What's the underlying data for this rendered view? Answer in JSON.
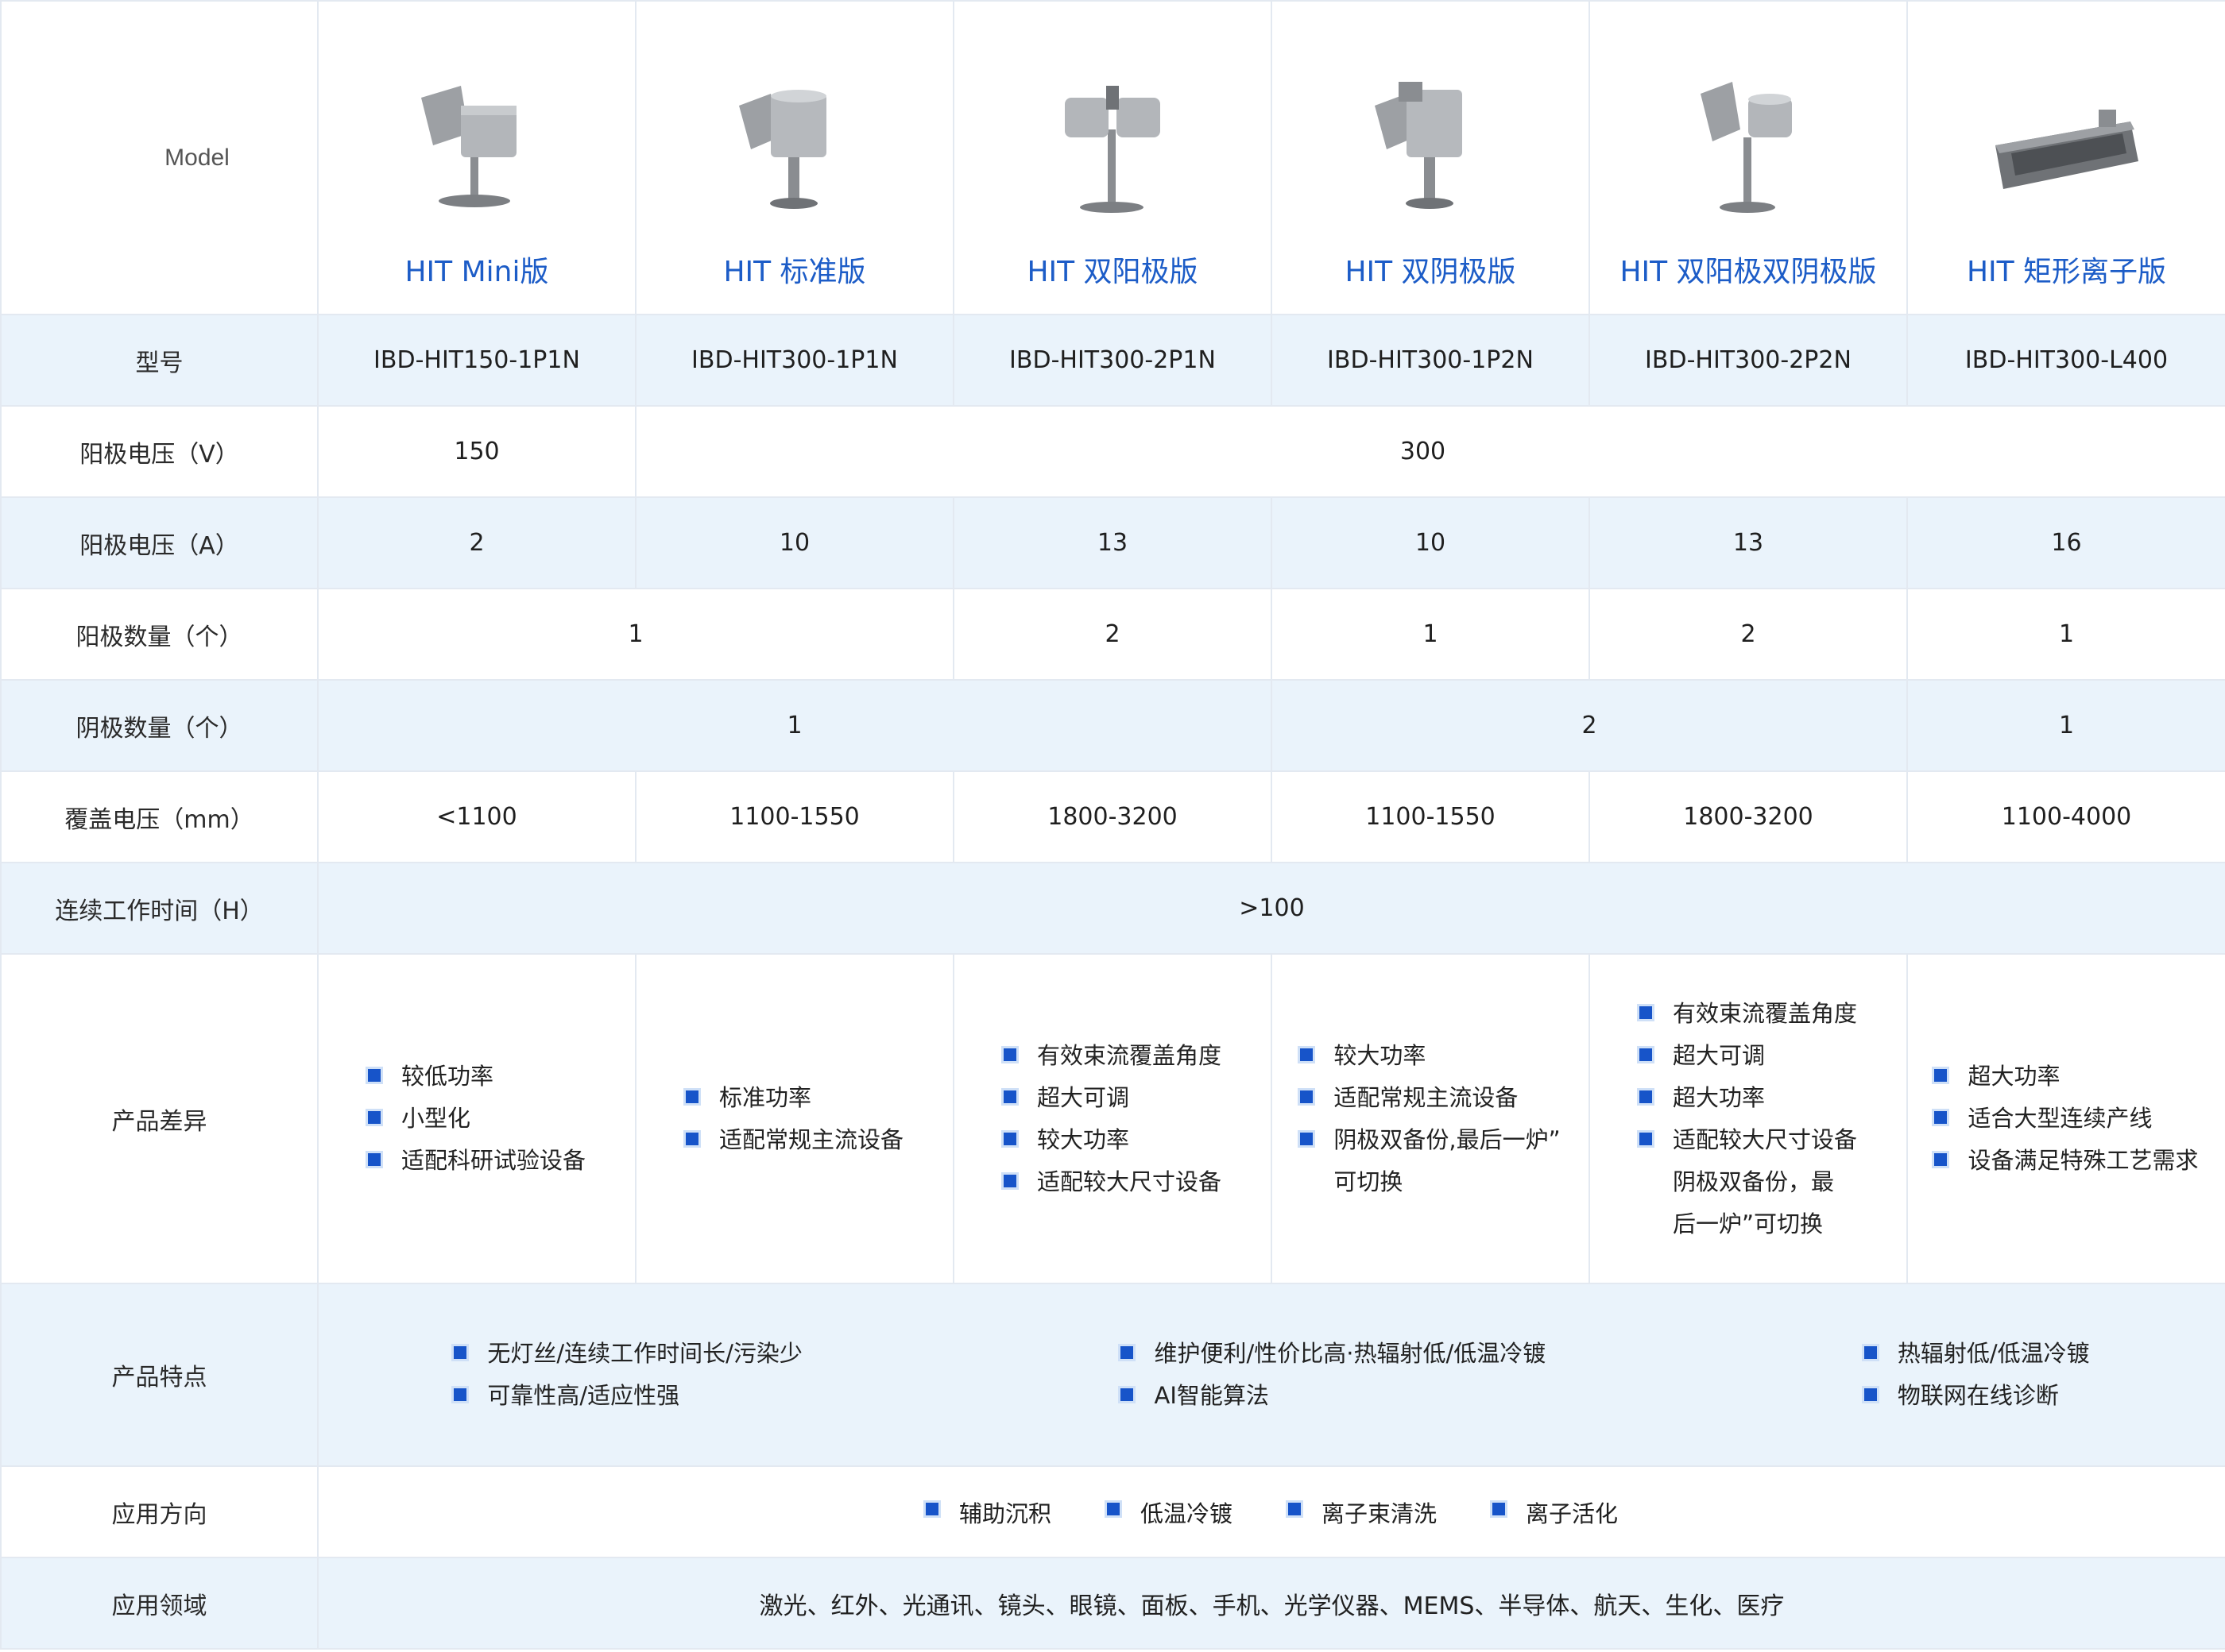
{
  "header": {
    "model_label": "Model"
  },
  "products": [
    {
      "name": "HIT Mini版",
      "icon": "mini-source-icon"
    },
    {
      "name": "HIT 标准版",
      "icon": "standard-source-icon"
    },
    {
      "name": "HIT 双阳极版",
      "icon": "dual-anode-source-icon"
    },
    {
      "name": "HIT 双阴极版",
      "icon": "dual-cathode-source-icon"
    },
    {
      "name": "HIT 双阳极双阴极版",
      "icon": "dual-anode-cathode-source-icon"
    },
    {
      "name": "HIT 矩形离子版",
      "icon": "rectangular-source-icon"
    }
  ],
  "rows": {
    "model": {
      "label": "型号",
      "values": [
        "IBD-HIT150-1P1N",
        "IBD-HIT300-1P1N",
        "IBD-HIT300-2P1N",
        "IBD-HIT300-1P2N",
        "IBD-HIT300-2P2N",
        "IBD-HIT300-L400"
      ]
    },
    "anode_voltage": {
      "label": "阳极电压（V）",
      "v150": "150",
      "v300": "300"
    },
    "anode_current": {
      "label": "阳极电压（A）",
      "values": [
        "2",
        "10",
        "13",
        "10",
        "13",
        "16"
      ]
    },
    "anode_count": {
      "label": "阳极数量（个）",
      "values": [
        "1",
        "2",
        "1",
        "2",
        "1"
      ]
    },
    "cathode_count": {
      "label": "阴极数量（个）",
      "values": [
        "1",
        "2",
        "1"
      ]
    },
    "coverage": {
      "label": "覆盖电压（mm）",
      "values": [
        "<1100",
        "1100-1550",
        "1800-3200",
        "1100-1550",
        "1800-3200",
        "1100-4000"
      ]
    },
    "runtime": {
      "label": "连续工作时间（H）",
      "value": ">100"
    },
    "diff": {
      "label": "产品差异",
      "cols": [
        [
          "较低功率",
          "小型化",
          "适配科研试验设备"
        ],
        [
          "标准功率",
          "适配常规主流设备"
        ],
        [
          "有效束流覆盖角度",
          "超大可调",
          "较大功率",
          "适配较大尺寸设备"
        ],
        [
          "较大功率",
          "适配常规主流设备",
          "阴极双备份,最后一炉”",
          "可切换"
        ],
        [
          "有效束流覆盖角度",
          "超大可调",
          "超大功率",
          "适配较大尺寸设备",
          "阴极双备份，最",
          "后一炉”可切换"
        ],
        [
          "超大功率",
          "适合大型连续产线",
          "设备满足特殊工艺需求"
        ]
      ]
    },
    "features": {
      "label": "产品特点",
      "groups": [
        [
          "无灯丝/连续工作时间长/污染少",
          "可靠性高/适应性强"
        ],
        [
          "维护便利/性价比高·热辐射低/低温冷镀",
          "AI智能算法"
        ],
        [
          "热辐射低/低温冷镀",
          "物联网在线诊断"
        ]
      ]
    },
    "applications": {
      "label": "应用方向",
      "items": [
        "辅助沉积",
        "低温冷镀",
        "离子束清洗",
        "离子活化"
      ]
    },
    "fields": {
      "label": "应用领域",
      "value": "激光、红外、光通讯、镜头、眼镜、面板、手机、光学仪器、MEMS、半导体、航天、生化、医疗"
    }
  }
}
